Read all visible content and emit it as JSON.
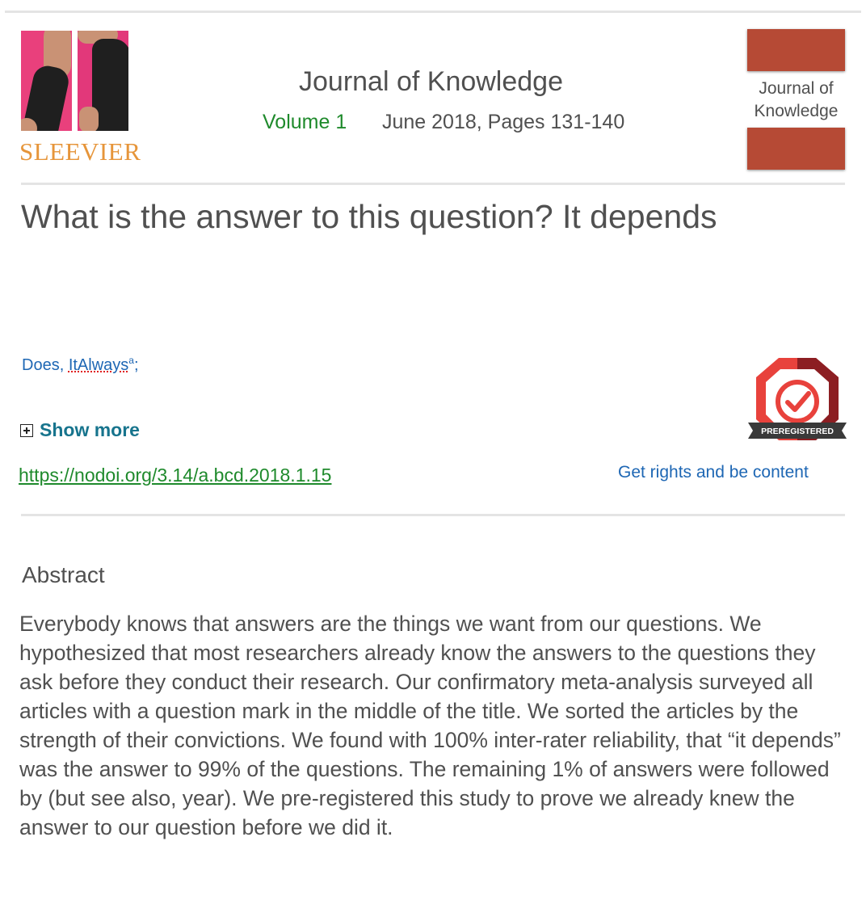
{
  "publisher": {
    "name": "SLEEVIER"
  },
  "journal": {
    "title": "Journal of Knowledge",
    "volume": "Volume 1",
    "date_pages": "June 2018, Pages 131-140",
    "cover_title": "Journal of Knowledge"
  },
  "article": {
    "title": "What is the answer to this question? It depends",
    "author_given": "Does, ",
    "author_surname": "ItAlways",
    "author_affil": "a",
    "author_sep": ";",
    "show_more_label": "Show more",
    "doi": "https://nodoi.org/3.14/a.bcd.2018.1.15",
    "rights_label": "Get rights and be content",
    "badge_label": "PREREGISTERED"
  },
  "abstract": {
    "heading": "Abstract",
    "text": "Everybody knows that answers are the things we want from our questions. We hypothesized that most researchers already know the answers to the questions they ask before they conduct their research. Our confirmatory meta-analysis surveyed all articles with a question mark in the middle of the title. We sorted the articles by the strength of their convictions. We found with 100% inter-rater reliability, that “it depends” was the answer to 99% of the questions. The remaining 1% of answers were followed by (but see also, year). We pre-registered this study to prove we already knew the answer to our question before we did it."
  },
  "colors": {
    "publisher_orange": "#e6953a",
    "volume_green": "#1f8a2c",
    "link_blue": "#1e67b4",
    "show_more_teal": "#17748d",
    "cover_red": "#b64a35",
    "badge_red": "#e8423c"
  }
}
